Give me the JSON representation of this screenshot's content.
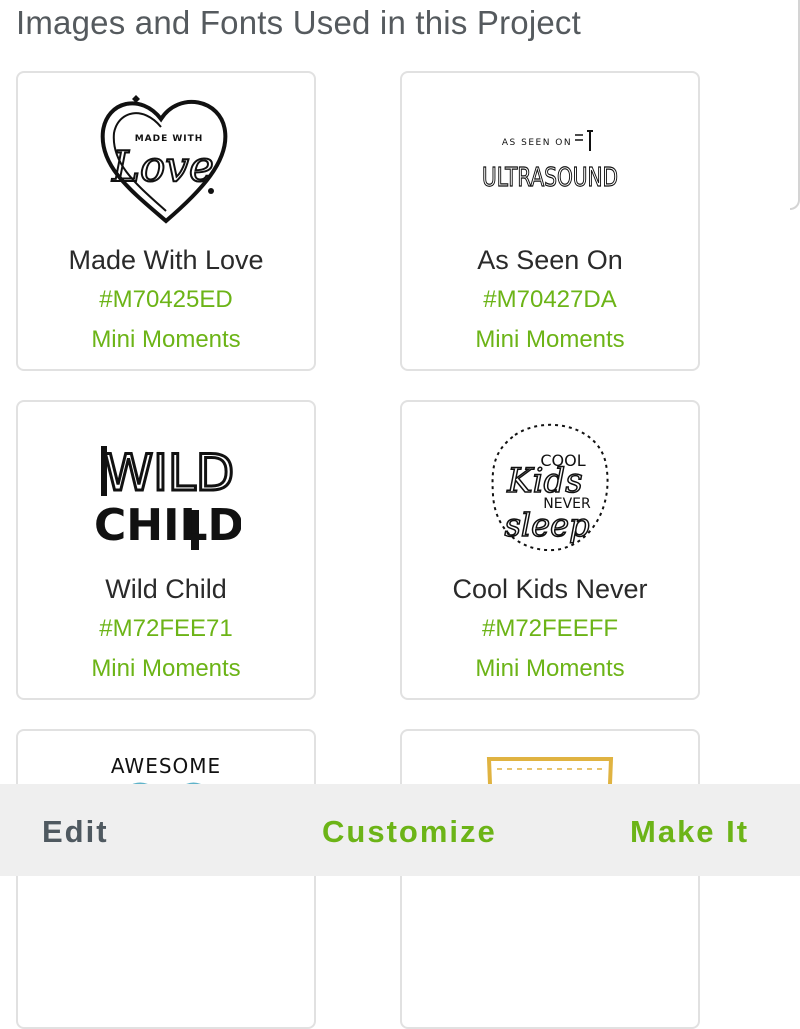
{
  "header": {
    "title": "Images and Fonts Used in this Project"
  },
  "cards": [
    {
      "name": "Made With Love",
      "code": "#M70425ED",
      "collection": "Mini Moments",
      "icon": "made-with-love-image"
    },
    {
      "name": "As Seen On",
      "code": "#M70427DA",
      "collection": "Mini Moments",
      "icon": "as-seen-on-ultrasound-image"
    },
    {
      "name": "Wild Child",
      "code": "#M72FEE71",
      "collection": "Mini Moments",
      "icon": "wild-child-image"
    },
    {
      "name": "Cool Kids Never",
      "code": "#M72FEEFF",
      "collection": "Mini Moments",
      "icon": "cool-kids-never-sleep-image"
    },
    {
      "name": "",
      "code": "",
      "collection": "",
      "icon": "awesome-image"
    },
    {
      "name": "",
      "code": "",
      "collection": "",
      "icon": "yellow-frame-image"
    }
  ],
  "artwork_text": {
    "made_with": "MADE WITH",
    "love": "Love",
    "as_seen_on": "AS SEEN ON",
    "ultrasound": "ULTRASOUND",
    "wild": "WILD",
    "child": "CHILD",
    "cool": "COOL",
    "kids": "Kids",
    "never": "NEVER",
    "sleep": "sleep",
    "awesome": "AWESOME"
  },
  "bottom_bar": {
    "edit_label": "Edit",
    "customize_label": "Customize",
    "make_label": "Make It"
  },
  "colors": {
    "accent_green": "#6cb417",
    "header_gray": "#555a5e",
    "bar_background": "#efefef",
    "edit_gray": "#4f5960"
  }
}
